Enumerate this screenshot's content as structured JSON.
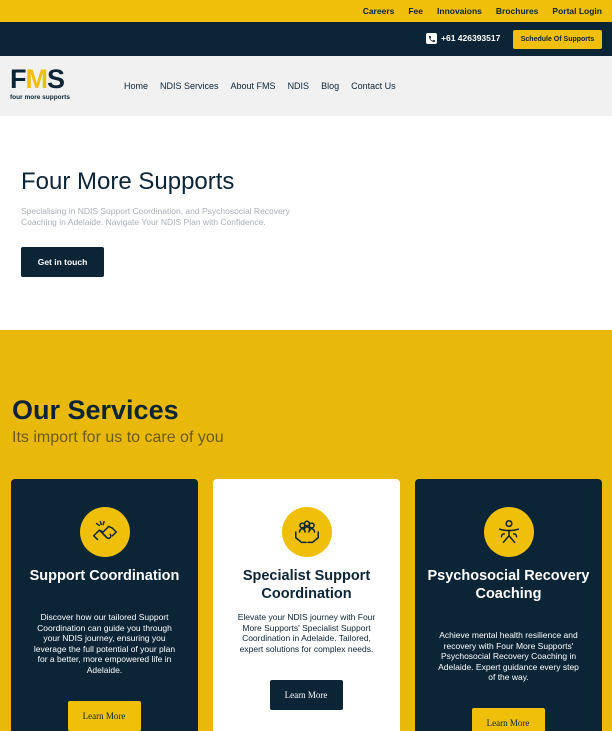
{
  "topbar": {
    "links": [
      "Careers",
      "Fee",
      "Innovaions",
      "Brochures",
      "Portal Login"
    ]
  },
  "contactbar": {
    "phone": "+61 426393517",
    "schedule_button": "Schedule Of Supports"
  },
  "header": {
    "logo_mark_dark_1": "F",
    "logo_mark_yellow": "M",
    "logo_mark_dark_2": "S",
    "logo_sub": "four more supports",
    "nav": [
      "Home",
      "NDIS Services",
      "About FMS",
      "NDIS",
      "Blog",
      "Contact Us"
    ]
  },
  "hero": {
    "title": "Four More Supports",
    "description": "Specialising in NDIS Support Coordination, and Psychosocial Recovery Coaching in Adelaide. Navigate Your NDIS Plan with Confidence.",
    "cta": "Get in touch"
  },
  "services": {
    "title": "Our Services",
    "subtitle": "Its import for us to care of you",
    "cards": [
      {
        "title": "Support Coordination",
        "description": "Discover how our tailored Support Coordination can guide you through your NDIS journey, ensuring you leverage the full potential of your plan for a better, more empowered life in Adelaide.",
        "button": "Learn More",
        "icon": "handshake-icon"
      },
      {
        "title": "Specialist Support Coordination",
        "description": "Elevate your NDIS journey with Four More Supports' Specialist Support Coordination in Adelaide. Tailored, expert solutions for complex needs.",
        "button": "Learn More",
        "icon": "hands-people-icon"
      },
      {
        "title": "Psychosocial Recovery Coaching",
        "description": "Achieve mental health resilience and recovery with Four More Supports' Psychosocial Recovery Coaching in Adelaide. Expert guidance every step of the way.",
        "button": "Learn More",
        "icon": "mental-health-icon"
      }
    ]
  },
  "colors": {
    "navy": "#0b2436",
    "yellow": "#efbf0a",
    "services_bg": "#e8b80b"
  }
}
